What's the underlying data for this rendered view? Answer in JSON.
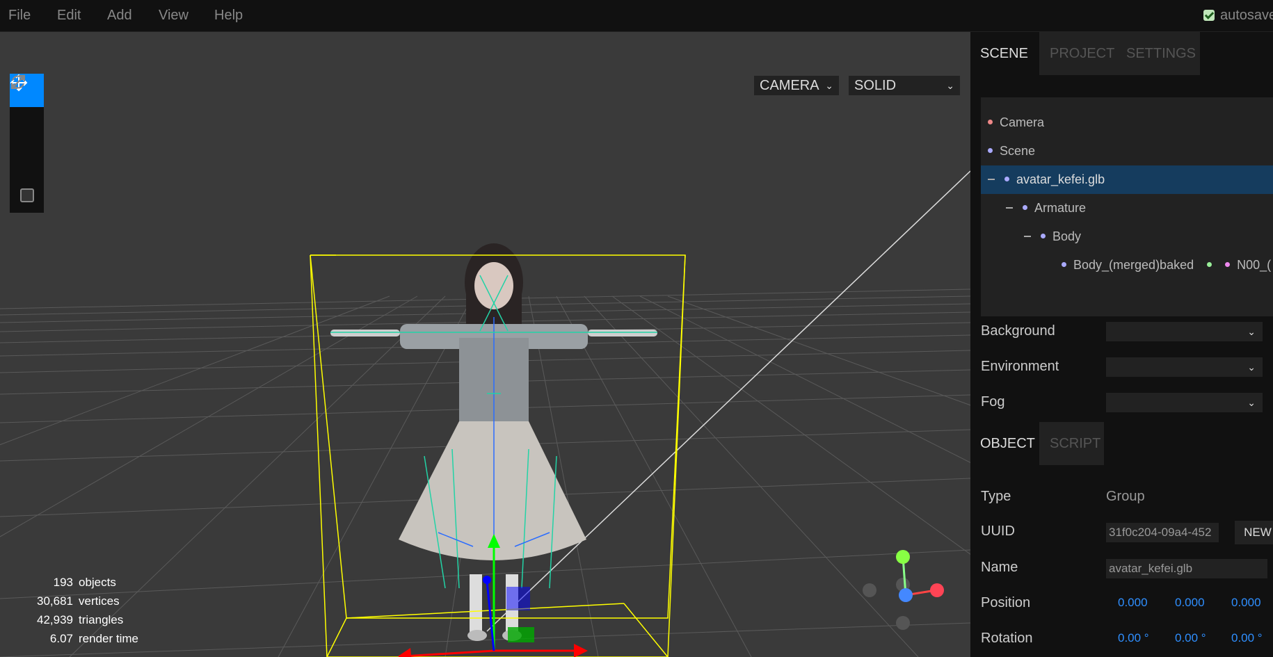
{
  "menubar": {
    "items": [
      "File",
      "Edit",
      "Add",
      "View",
      "Help"
    ],
    "autosave": "autosave",
    "autosave_checked": true
  },
  "viewport": {
    "camera_select": "CAMERA",
    "shading_select": "SOLID",
    "tools": [
      "move-icon",
      "rotate-icon",
      "scale-icon",
      "local-toggle"
    ],
    "info": [
      {
        "value": "193",
        "label": "objects"
      },
      {
        "value": "30,681",
        "label": "vertices"
      },
      {
        "value": "42,939",
        "label": "triangles"
      },
      {
        "value": "6.07",
        "label": "render time"
      }
    ]
  },
  "sidebar": {
    "tabs": [
      "SCENE",
      "PROJECT",
      "SETTINGS"
    ],
    "active_tab": "SCENE",
    "outliner": [
      {
        "label": "Camera",
        "color": "#e88",
        "depth": 0,
        "collapse": false
      },
      {
        "label": "Scene",
        "color": "#aaf",
        "depth": 0,
        "collapse": false
      },
      {
        "label": "avatar_kefei.glb",
        "color": "#aaf",
        "depth": 0,
        "collapse": true,
        "selected": true
      },
      {
        "label": "Armature",
        "color": "#aaf",
        "depth": 1,
        "collapse": true
      },
      {
        "label": "Body",
        "color": "#aaf",
        "depth": 2,
        "collapse": true
      },
      {
        "label": "Body_(merged)baked",
        "color": "#aaf",
        "depth": 3,
        "collapse": false,
        "extra": [
          {
            "color": "#9e9",
            "label": ""
          },
          {
            "color": "#e8e",
            "label": "N00_("
          }
        ]
      }
    ],
    "background_label": "Background",
    "environment_label": "Environment",
    "fog_label": "Fog",
    "object_tabs": [
      "OBJECT",
      "SCRIPT"
    ],
    "object": {
      "type_label": "Type",
      "type_value": "Group",
      "uuid_label": "UUID",
      "uuid_value": "31f0c204-09a4-452",
      "new_label": "NEW",
      "name_label": "Name",
      "name_value": "avatar_kefei.glb",
      "position_label": "Position",
      "position": [
        "0.000",
        "0.000",
        "0.000"
      ],
      "rotation_label": "Rotation",
      "rotation": [
        "0.00 °",
        "0.00 °",
        "0.00 °"
      ]
    }
  },
  "colors": {
    "accent": "#0088ff",
    "selected_row": "#153c5e",
    "bbox": "#ffff00",
    "number": "#2f8fff"
  }
}
